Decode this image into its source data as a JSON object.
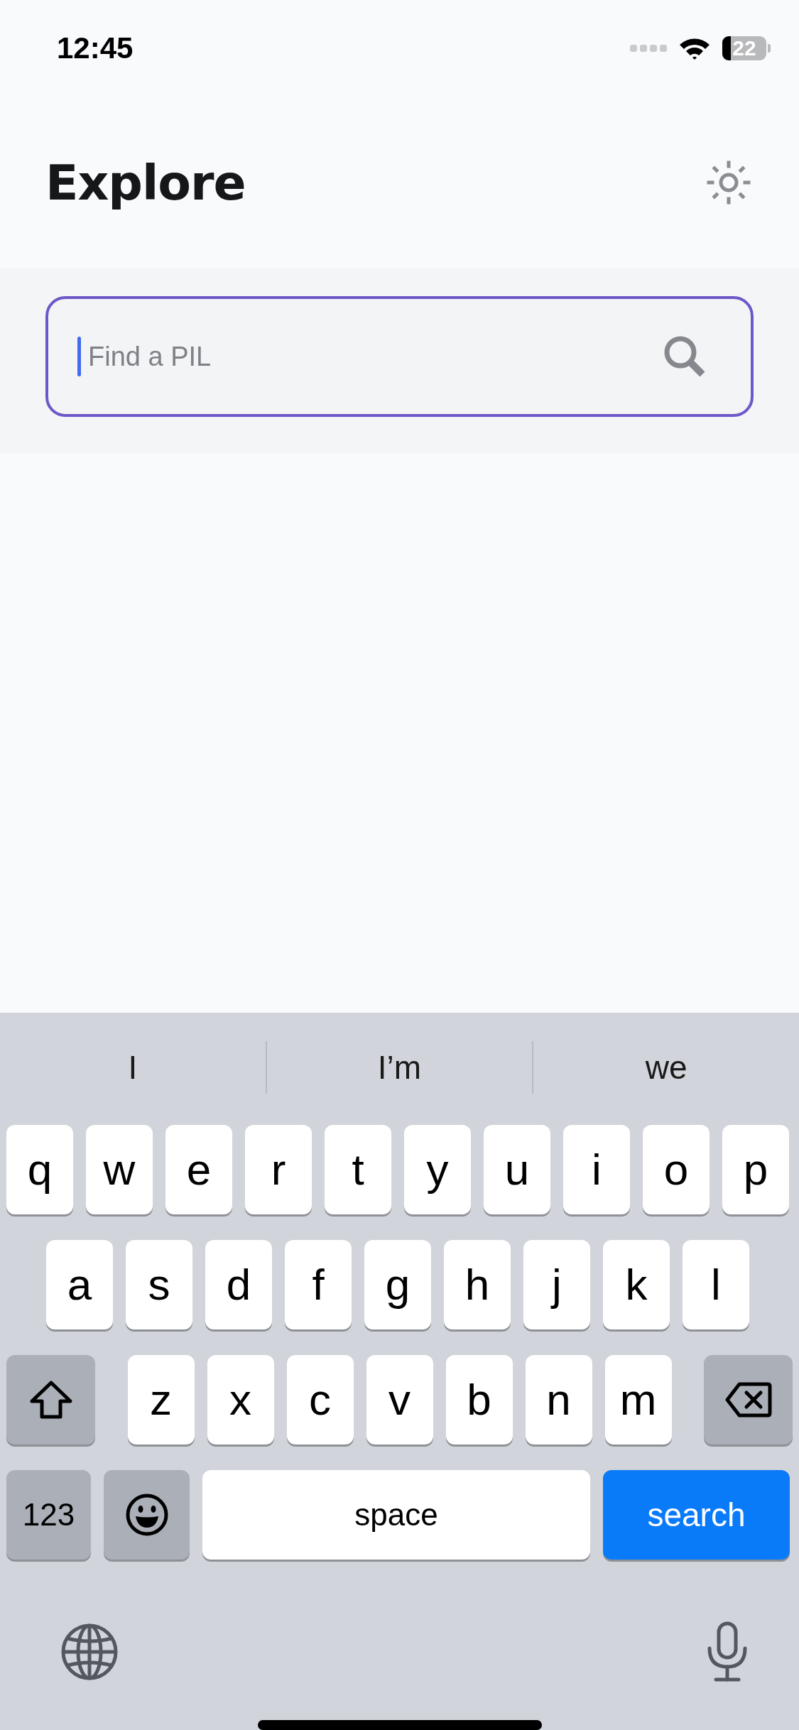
{
  "status_bar": {
    "time": "12:45",
    "battery": "22"
  },
  "header": {
    "title": "Explore"
  },
  "search": {
    "placeholder": "Find a PIL",
    "focused": true
  },
  "keyboard": {
    "suggestions": [
      "I",
      "I’m",
      "we"
    ],
    "rows": [
      [
        "q",
        "w",
        "e",
        "r",
        "t",
        "y",
        "u",
        "i",
        "o",
        "p"
      ],
      [
        "a",
        "s",
        "d",
        "f",
        "g",
        "h",
        "j",
        "k",
        "l"
      ],
      [
        "z",
        "x",
        "c",
        "v",
        "b",
        "n",
        "m"
      ]
    ],
    "numbers_key": "123",
    "space_key": "space",
    "action_key": "search"
  }
}
